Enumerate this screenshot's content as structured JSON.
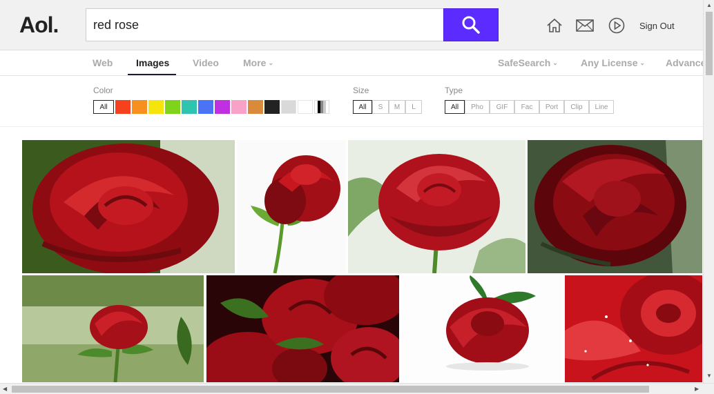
{
  "header": {
    "logo": "Aol.",
    "search_value": "red rose",
    "icons": [
      "search-icon",
      "home-icon",
      "mail-icon",
      "play-icon"
    ],
    "signout_label": "Sign Out",
    "accent_color": "#5b2bff"
  },
  "nav": {
    "tabs": [
      {
        "label": "Web",
        "active": false
      },
      {
        "label": "Images",
        "active": true
      },
      {
        "label": "Video",
        "active": false
      },
      {
        "label": "More",
        "active": false
      }
    ],
    "right": [
      {
        "label": "SafeSearch"
      },
      {
        "label": "Any License"
      },
      {
        "label": "Advanced"
      }
    ]
  },
  "filters": {
    "color_label": "Color",
    "color_all": "All",
    "colors": [
      "#f5421d",
      "#f7901e",
      "#f5e50d",
      "#7fd41b",
      "#2ec4b0",
      "#4a74f5",
      "#c030e0",
      "#f7a2c6",
      "#d98a3b",
      "#222222",
      "#d9d9d9",
      "#ffffff"
    ],
    "size_label": "Size",
    "sizes": [
      "All",
      "S",
      "M",
      "L"
    ],
    "type_label": "Type",
    "types": [
      "All",
      "Pho",
      "GIF",
      "Fac",
      "Port",
      "Clip",
      "Line"
    ]
  },
  "images": {
    "row1": [
      "red-rose-image-1",
      "red-rose-image-2",
      "red-rose-image-3",
      "red-rose-image-4"
    ],
    "row2": [
      "red-rose-image-5",
      "red-rose-image-6",
      "red-rose-image-7",
      "red-rose-image-8"
    ]
  }
}
